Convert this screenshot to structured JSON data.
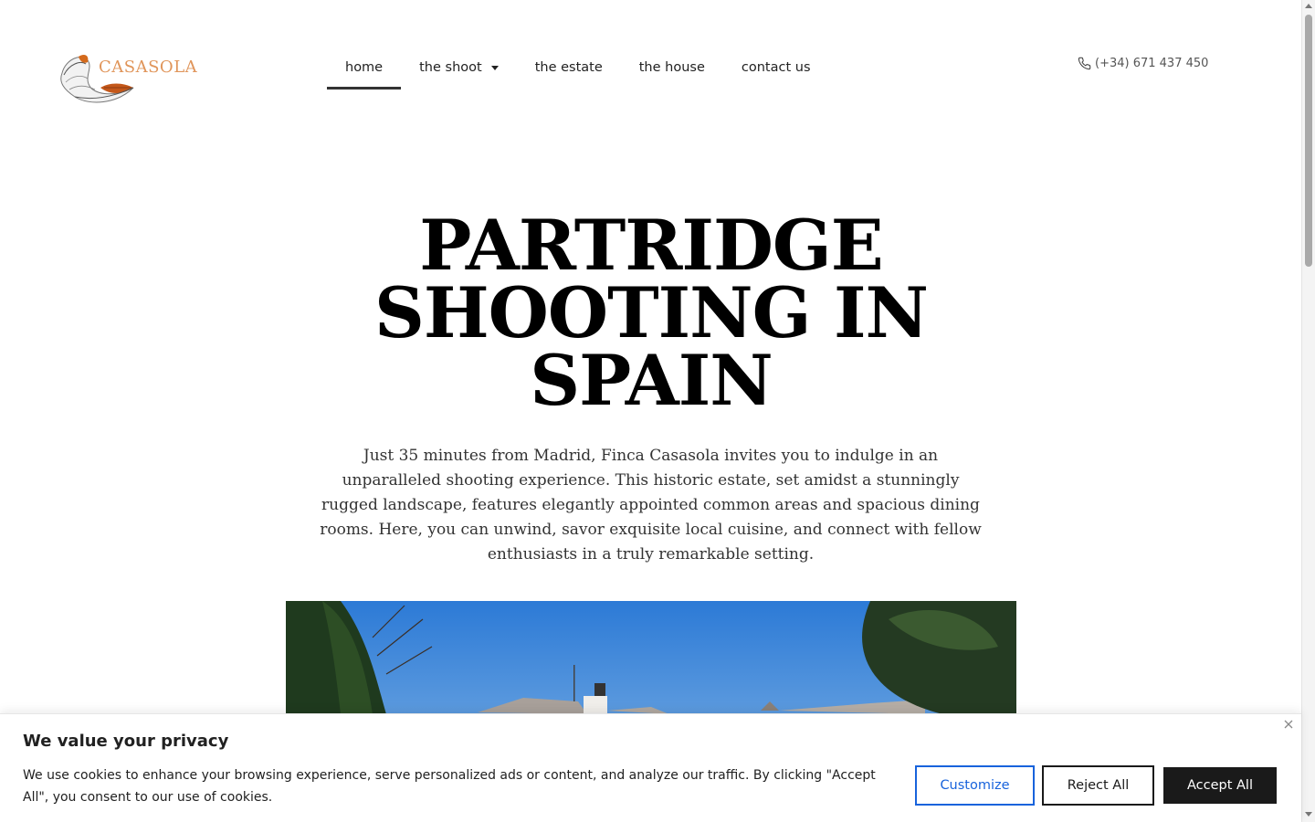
{
  "brand": {
    "name": "CASASOLA"
  },
  "nav": {
    "items": [
      {
        "label": "home",
        "active": true
      },
      {
        "label": "the shoot",
        "has_dropdown": true
      },
      {
        "label": "the estate"
      },
      {
        "label": "the house"
      },
      {
        "label": "contact us"
      }
    ]
  },
  "header": {
    "phone": "(+34) 671 437 450",
    "phone_icon": "phone-icon"
  },
  "hero": {
    "title_line1": "PARTRIDGE",
    "title_line2": "SHOOTING IN",
    "title_line3": "SPAIN",
    "text": "Just 35 minutes from Madrid, Finca Casasola invites you to indulge in an unparalleled shooting experience. This historic estate, set amidst a stunningly rugged landscape, features elegantly appointed common areas and spacious dining rooms. Here, you can unwind, savor exquisite local cuisine, and connect with fellow enthusiasts in a truly remarkable setting."
  },
  "cookie_banner": {
    "title": "We value your privacy",
    "text": "We use cookies to enhance your browsing experience, serve personalized ads or content, and analyze our traffic. By clicking \"Accept All\", you consent to our use of cookies.",
    "customize_label": "Customize",
    "reject_label": "Reject All",
    "accept_label": "Accept All",
    "colors": {
      "customize": "#1863dc",
      "accept_bg": "#1a1a1a"
    }
  }
}
